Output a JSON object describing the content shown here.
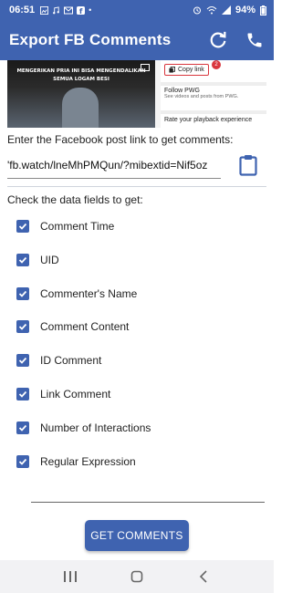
{
  "status_bar": {
    "time": "06:51",
    "battery": "94%"
  },
  "app_bar": {
    "title": "Export FB Comments"
  },
  "preview": {
    "video_caption": "MENGERIKAN PRIA INI BISA MENGENDALIKAN SEMUA LOGAM BESI",
    "copy_link": "Copy link",
    "copy_badge": "2",
    "follow_title": "Follow PWG",
    "follow_sub": "See videos and posts from PWG.",
    "rate": "Rate your playback experience"
  },
  "link": {
    "prompt": "Enter the Facebook post link to get comments:",
    "value": "'fb.watch/lneMhPMQun/?mibextid=Nif5oz"
  },
  "fields": {
    "title": "Check the data fields to get:",
    "items": [
      {
        "label": "Comment Time",
        "checked": true
      },
      {
        "label": "UID",
        "checked": true
      },
      {
        "label": "Commenter's Name",
        "checked": true
      },
      {
        "label": "Comment Content",
        "checked": true
      },
      {
        "label": "ID Comment",
        "checked": true
      },
      {
        "label": "Link Comment",
        "checked": true
      },
      {
        "label": "Number of Interactions",
        "checked": true
      },
      {
        "label": "Regular Expression",
        "checked": true
      }
    ]
  },
  "actions": {
    "get_comments": "GET COMMENTS"
  },
  "colors": {
    "primary": "#3f63b0",
    "badge": "#d9363e"
  }
}
